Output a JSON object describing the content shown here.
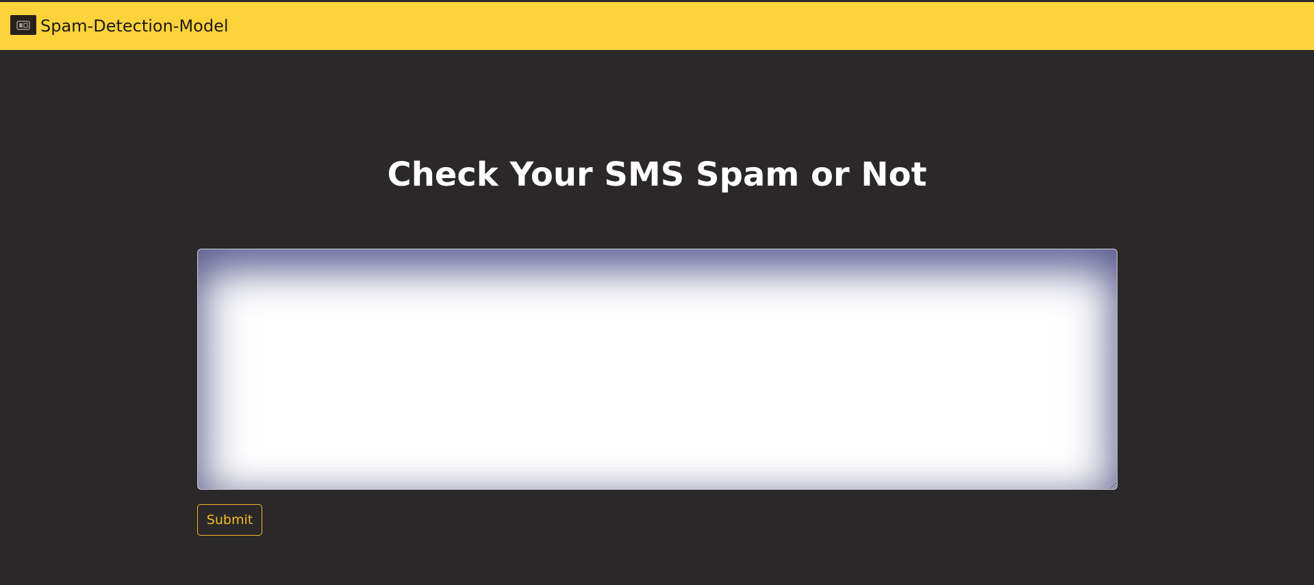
{
  "navbar": {
    "brand_name": "Spam-Detection-Model",
    "logo_icon": "brand-logo-icon",
    "background_color": "#fcd33b"
  },
  "main": {
    "heading": "Check Your SMS Spam or Not",
    "sms_input": {
      "value": "",
      "placeholder": ""
    },
    "submit_label": "Submit"
  },
  "colors": {
    "page_background": "#2a2829",
    "accent": "#f4bd25",
    "heading_text": "#ffffff"
  }
}
